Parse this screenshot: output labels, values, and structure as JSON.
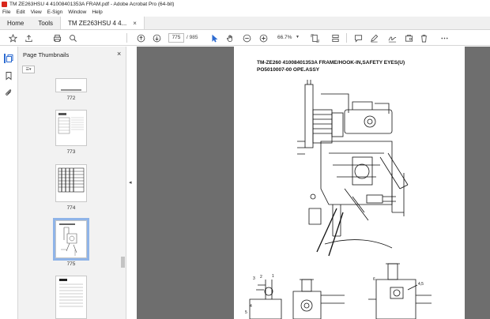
{
  "window": {
    "title": "TM ZE263HSU 4 41008401353A FRAM.pdf - Adobe Acrobat Pro (64-bit)"
  },
  "menu": [
    "File",
    "Edit",
    "View",
    "E-Sign",
    "Window",
    "Help"
  ],
  "tabs": {
    "home": "Home",
    "tools": "Tools",
    "document": "TM ZE263HSU 4 4...",
    "close_glyph": "×"
  },
  "toolbar": {
    "page_current": "775",
    "page_total": "/ 985",
    "zoom": "66.7%",
    "icons": [
      "star-icon",
      "upload-icon",
      "print-icon",
      "search-icon",
      "prev-page-icon",
      "next-page-icon",
      "select-cursor-icon",
      "hand-icon",
      "zoom-out-icon",
      "zoom-in-icon",
      "fit-page-icon",
      "scroll-mode-icon",
      "comment-icon",
      "highlight-pen-icon",
      "sign-icon",
      "stamp-icon",
      "delete-icon",
      "more-icon"
    ]
  },
  "thumbnails": {
    "panel_title": "Page Thumbnails",
    "close_glyph": "×",
    "options_glyph": "☰▾",
    "pages": [
      {
        "label": "772"
      },
      {
        "label": "773"
      },
      {
        "label": "774"
      },
      {
        "label": "775",
        "selected": true
      },
      {
        "label": ""
      }
    ]
  },
  "document": {
    "title_line1": "TM-ZE260 41008401353A FRAME/HOOK-IN,SAFETY EYES(U)",
    "title_line2": "PO5010007-00 OPE.ASSY",
    "callouts": [
      "3",
      "2",
      "1",
      "4",
      "5",
      "6",
      "4,5"
    ]
  },
  "colors": {
    "accent": "#2d6bd1",
    "app_icon": "#d9271c",
    "doc_background": "#6e6e6e",
    "panel_background": "#f2f2f2"
  }
}
